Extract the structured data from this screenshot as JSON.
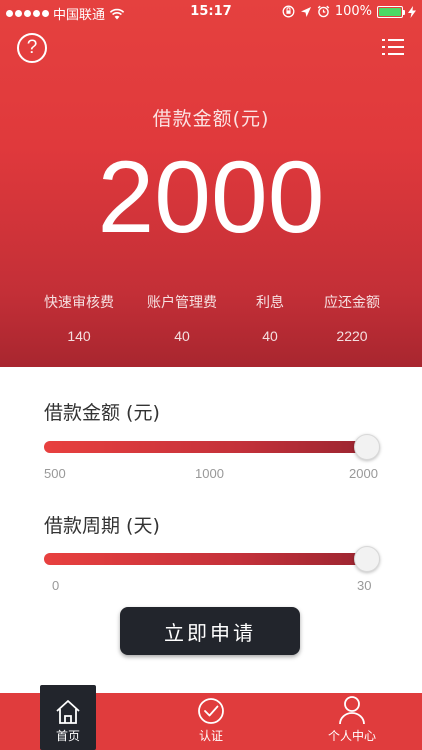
{
  "status_bar": {
    "carrier": "中国联通",
    "time": "15:17",
    "battery": "100%",
    "battery_level": 1.0
  },
  "header": {
    "help_icon": "question-circle-icon",
    "menu_icon": "list-menu-icon"
  },
  "summary": {
    "title": "借款金额(元)",
    "amount": "2000",
    "fees": [
      {
        "label": "快速审核费",
        "value": "140"
      },
      {
        "label": "账户管理费",
        "value": "40"
      },
      {
        "label": "利息",
        "value": "40"
      },
      {
        "label": "应还金额",
        "value": "2220"
      }
    ]
  },
  "amount_slider": {
    "label": "借款金额 (元)",
    "min": 500,
    "max": 2000,
    "value": 2000,
    "ticks": [
      "500",
      "1000",
      "2000"
    ]
  },
  "period_slider": {
    "label": "借款周期 (天)",
    "min": 0,
    "max": 30,
    "value": 30,
    "ticks": [
      "0",
      "30"
    ]
  },
  "apply_button": {
    "label": "立即申请"
  },
  "colors": {
    "brand_red": "#e03c3d",
    "dark": "#22252c"
  },
  "tabbar": {
    "tabs": [
      {
        "label": "首页",
        "icon": "home-icon",
        "active": true
      },
      {
        "label": "认证",
        "icon": "check-circle-icon",
        "active": false
      },
      {
        "label": "个人中心",
        "icon": "user-icon",
        "active": false
      }
    ]
  }
}
